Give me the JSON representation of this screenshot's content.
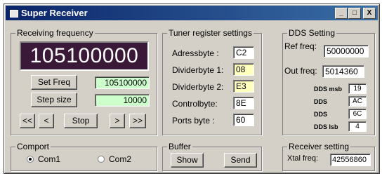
{
  "window": {
    "title": "Super Receiver",
    "minimize": "_",
    "maximize": "□",
    "close": "X"
  },
  "receiving": {
    "legend": "Receiving frequency",
    "display": "105100000",
    "set_freq_label": "Set Freq",
    "set_freq_value": "105100000",
    "step_size_label": "Step size",
    "step_size_value": "10000",
    "nav": {
      "fast_back": "<<",
      "back": "<",
      "stop": "Stop",
      "forward": ">",
      "fast_forward": ">>"
    }
  },
  "tuner": {
    "legend": "Tuner register settings",
    "rows": [
      {
        "label": "Adressbyte :",
        "value": "C2"
      },
      {
        "label": "Dividerbyte 1:",
        "value": "08"
      },
      {
        "label": "Dividerbyte 2:",
        "value": "E3"
      },
      {
        "label": "Controlbyte:",
        "value": "8E"
      },
      {
        "label": "Ports byte :",
        "value": "60"
      }
    ]
  },
  "dds": {
    "legend": "DDS Setting",
    "ref_label": "Ref freq:",
    "ref_value": "50000000",
    "out_label": "Out freq:",
    "out_value": "5014360",
    "bytes": [
      {
        "label": "DDS msb",
        "value": "19"
      },
      {
        "label": "DDS",
        "value": "AC"
      },
      {
        "label": "DDS",
        "value": "6C"
      },
      {
        "label": "DDS lsb",
        "value": "4"
      }
    ]
  },
  "comport": {
    "legend": "Comport",
    "com1": "Com1",
    "com2": "Com2"
  },
  "buffer": {
    "legend": "Buffer",
    "show": "Show",
    "send": "Send"
  },
  "receiver": {
    "legend": "Receiver setting",
    "xtal_label": "Xtal freq:",
    "xtal_value": "42556860"
  }
}
